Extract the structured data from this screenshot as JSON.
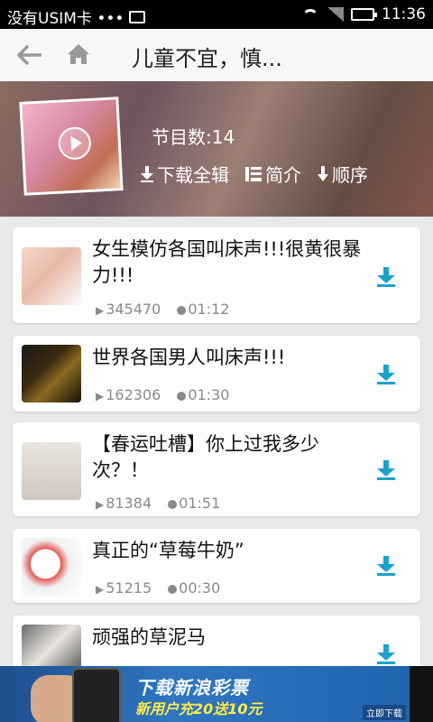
{
  "status_bar": {
    "carrier": "没有USIM卡 •••",
    "time": "11:36"
  },
  "action_bar": {
    "title": "儿童不宜，慎..."
  },
  "header": {
    "episode_count": "节目数:14",
    "download_all": "下载全辑",
    "intro": "简介",
    "order": "顺序"
  },
  "episodes": [
    {
      "title": "女生模仿各国叫床声!!!很黄很暴力!!!",
      "plays": "345470",
      "duration": "01:12"
    },
    {
      "title": "世界各国男人叫床声!!!",
      "plays": "162306",
      "duration": "01:30"
    },
    {
      "title": "【春运吐槽】你上过我多少次？！",
      "plays": "81384",
      "duration": "01:51"
    },
    {
      "title": "真正的“草莓牛奶”",
      "plays": "51215",
      "duration": "00:30"
    },
    {
      "title": "顽强的草泥马",
      "plays": "",
      "duration": ""
    }
  ],
  "ad": {
    "line1": "下载新浪彩票",
    "line2": "新用户充20送10元",
    "cta": "立即下载"
  }
}
